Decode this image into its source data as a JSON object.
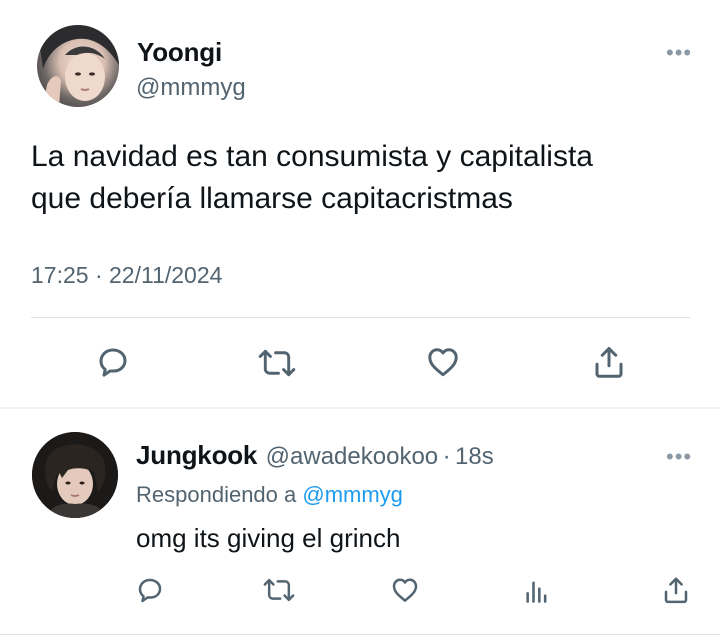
{
  "tweet": {
    "author": {
      "name": "Yoongi",
      "handle": "@mmmyg"
    },
    "more_label": "•••",
    "text_line1": "La navidad es tan consumista y capitalista",
    "text_line2": "que debería llamarse capitacristmas",
    "time": "17:25",
    "separator": "·",
    "date": "22/11/2024",
    "actions": [
      "reply-icon",
      "retweet-icon",
      "like-icon",
      "share-icon"
    ]
  },
  "reply": {
    "author": {
      "name": "Jungkook",
      "handle": "@awadekookoo"
    },
    "separator": "·",
    "time_ago": "18s",
    "replying_prefix": "Respondiendo a",
    "replying_handle": "@mmmyg",
    "text": "omg its giving el grinch",
    "more_label": "•••",
    "actions": [
      "reply-icon",
      "retweet-icon",
      "like-icon",
      "views-icon",
      "share-icon"
    ]
  },
  "colors": {
    "text": "#0f1419",
    "secondary": "#536471",
    "link": "#1d9bf0",
    "divider": "#dfe3e7"
  }
}
